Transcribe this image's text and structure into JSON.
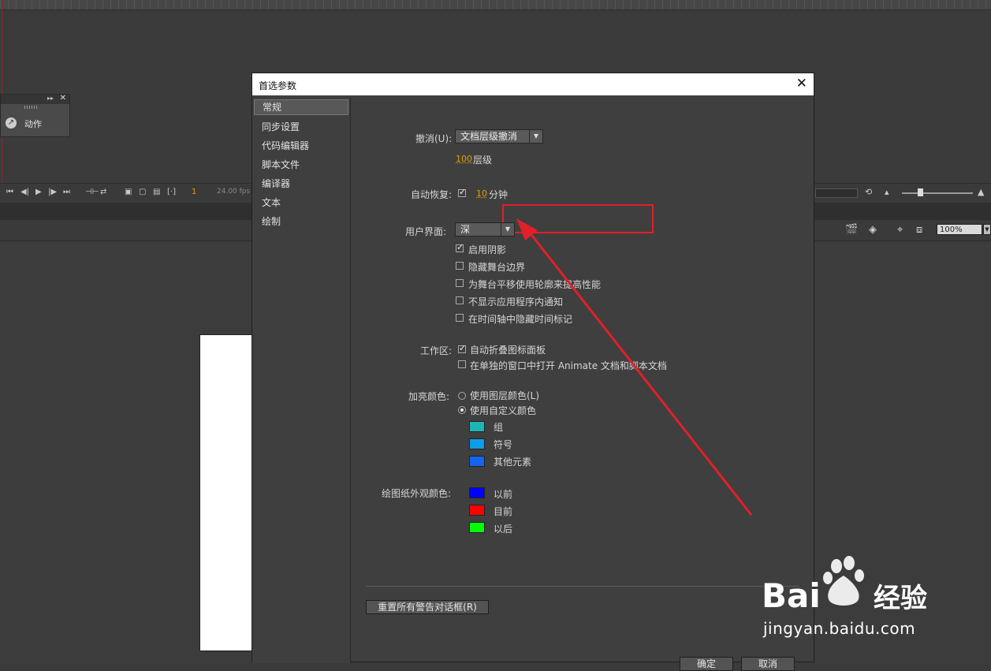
{
  "app": {
    "actions_panel": {
      "label": "动作",
      "collapse_icon": "double-chevron-right-icon",
      "close_icon": "close-icon"
    },
    "timeline": {
      "frame": "1",
      "fps": "24.00 fps"
    },
    "zoom": "100%"
  },
  "dialog": {
    "title": "首选参数",
    "close_icon": "close-icon",
    "sidebar": [
      {
        "label": "常规",
        "active": true
      },
      {
        "label": "同步设置"
      },
      {
        "label": "代码编辑器"
      },
      {
        "label": "脚本文件"
      },
      {
        "label": "编译器"
      },
      {
        "label": "文本"
      },
      {
        "label": "绘制"
      }
    ],
    "undo": {
      "label": "撤消(U):",
      "value": "文档层级撤消",
      "count": "100",
      "count_unit": "层级"
    },
    "autorecover": {
      "label": "自动恢复:",
      "checked": true,
      "value": "10",
      "unit": "分钟"
    },
    "ui": {
      "label": "用户界面:",
      "value": "深",
      "options": [
        {
          "label": "启用阴影",
          "checked": true
        },
        {
          "label": "隐藏舞台边界",
          "checked": false
        },
        {
          "label": "为舞台平移使用轮廓来提高性能",
          "checked": false
        },
        {
          "label": "不显示应用程序内通知",
          "checked": false
        },
        {
          "label": "在时间轴中隐藏时间标记",
          "checked": false
        }
      ]
    },
    "workspace": {
      "label": "工作区:",
      "options": [
        {
          "label": "自动折叠图标面板",
          "checked": true
        },
        {
          "label": "在单独的窗口中打开 Animate 文档和脚本文档",
          "checked": false
        }
      ]
    },
    "highlight": {
      "label": "加亮颜色:",
      "radios": [
        {
          "label": "使用图层颜色(L)",
          "selected": false
        },
        {
          "label": "使用自定义颜色",
          "selected": true
        }
      ],
      "swatches": [
        {
          "label": "组",
          "color": "#1fb5b5"
        },
        {
          "label": "符号",
          "color": "#0e9ce8"
        },
        {
          "label": "其他元素",
          "color": "#1464f0"
        }
      ]
    },
    "onion": {
      "label": "绘图纸外观颜色:",
      "swatches": [
        {
          "label": "以前",
          "color": "#0000ff"
        },
        {
          "label": "目前",
          "color": "#ff0000"
        },
        {
          "label": "以后",
          "color": "#00ff00"
        }
      ]
    },
    "reset_button": "重置所有警告对话框(R)",
    "ok_button": "确定",
    "cancel_button": "取消"
  },
  "watermark": {
    "text": "jingyan.baidu.com",
    "brand_left": "Bai",
    "brand_right": "经验"
  },
  "colors": {
    "annotation_red": "#e0202a",
    "dialog_bg": "#3f3f3f",
    "accent_number": "#e0a000"
  }
}
